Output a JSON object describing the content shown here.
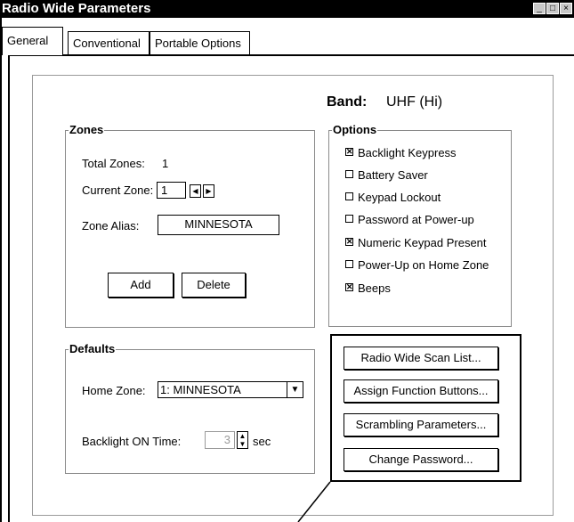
{
  "window": {
    "title": "Radio Wide Parameters",
    "controls": [
      "_",
      "□",
      "×"
    ]
  },
  "tabs": [
    {
      "label": "General",
      "active": true
    },
    {
      "label": "Conventional",
      "active": false
    },
    {
      "label": "Portable Options",
      "active": false
    }
  ],
  "band": {
    "label": "Band:",
    "value": "UHF (Hi)"
  },
  "zones": {
    "title": "Zones",
    "total_label": "Total Zones:",
    "total_value": "1",
    "current_label": "Current Zone:",
    "current_value": "1",
    "alias_label": "Zone Alias:",
    "alias_value": "MINNESOTA",
    "add_label": "Add",
    "delete_label": "Delete"
  },
  "options": {
    "title": "Options",
    "items": [
      {
        "label": "Backlight Keypress",
        "checked": true
      },
      {
        "label": "Battery Saver",
        "checked": false
      },
      {
        "label": "Keypad Lockout",
        "checked": false
      },
      {
        "label": "Password at Power-up",
        "checked": false
      },
      {
        "label": "Numeric Keypad Present",
        "checked": true
      },
      {
        "label": "Power-Up on Home Zone",
        "checked": false
      },
      {
        "label": "Beeps",
        "checked": true
      }
    ]
  },
  "defaults": {
    "title": "Defaults",
    "home_zone_label": "Home Zone:",
    "home_zone_value": "1: MINNESOTA",
    "backlight_label": "Backlight ON Time:",
    "backlight_value": "3",
    "backlight_unit": "sec"
  },
  "actions": {
    "scan_list": "Radio Wide Scan List...",
    "function_buttons": "Assign Function Buttons...",
    "scrambling": "Scrambling Parameters...",
    "password": "Change Password..."
  }
}
